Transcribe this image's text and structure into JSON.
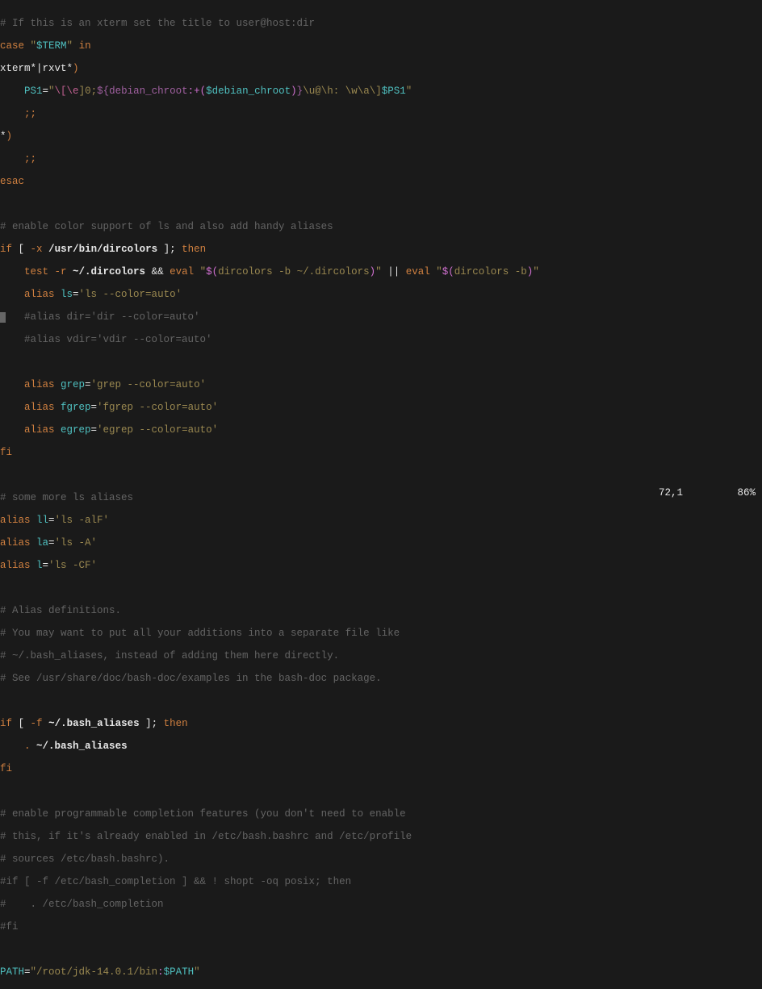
{
  "lines": {
    "l1": "# If this is an xterm set the title to user@host:dir",
    "l2a": "case ",
    "l2b": "\"",
    "l2c": "$TERM",
    "l2d": "\"",
    "l2e": " in",
    "l3a": "xterm*|rxvt*",
    "l3b": ")",
    "l4a": "    PS1",
    "l4b": "=",
    "l4c": "\"",
    "l4d": "\\[\\e",
    "l4e": "]0;",
    "l4f": "${debian_chroot",
    "l4g": ":+(",
    "l4h": "$debian_chroot",
    "l4i": ")",
    "l4j": "}",
    "l4k": "\\u@\\h: \\w\\a\\]",
    "l4l": "$PS1",
    "l4m": "\"",
    "l5": "    ;;",
    "l6a": "*",
    "l6b": ")",
    "l7": "    ;;",
    "l8": "esac",
    "l9": "",
    "l10": "# enable color support of ls and also add handy aliases",
    "l11a": "if",
    "l11b": " [ ",
    "l11c": "-x",
    "l11d": " ",
    "l11e": "/usr/bin/dircolors",
    "l11f": " ];",
    "l11g": " then",
    "l12a": "    test ",
    "l12b": "-r",
    "l12c": " ",
    "l12d": "~/.dircolors",
    "l12e": " && ",
    "l12f": "eval",
    "l12g": " ",
    "l12h": "\"",
    "l12i": "$(",
    "l12j": "dircolors -b ~/.dircolors",
    "l12k": ")",
    "l12l": "\"",
    "l12m": " || ",
    "l12n": "eval",
    "l12o": " ",
    "l12p": "\"",
    "l12q": "$(",
    "l12r": "dircolors -b",
    "l12s": ")",
    "l12t": "\"",
    "l13a": "    alias ",
    "l13b": "ls",
    "l13c": "=",
    "l13d": "'ls --color=auto'",
    "l14a": "    ",
    "l14b": "#alias dir='dir --color=auto'",
    "l15": "    #alias vdir='vdir --color=auto'",
    "l16": "",
    "l17a": "    alias ",
    "l17b": "grep",
    "l17c": "=",
    "l17d": "'grep --color=auto'",
    "l18a": "    alias ",
    "l18b": "fgrep",
    "l18c": "=",
    "l18d": "'fgrep --color=auto'",
    "l19a": "    alias ",
    "l19b": "egrep",
    "l19c": "=",
    "l19d": "'egrep --color=auto'",
    "l20": "fi",
    "l21": "",
    "l22": "# some more ls aliases",
    "l23a": "alias ",
    "l23b": "ll",
    "l23c": "=",
    "l23d": "'ls -alF'",
    "l24a": "alias ",
    "l24b": "la",
    "l24c": "=",
    "l24d": "'ls -A'",
    "l25a": "alias ",
    "l25b": "l",
    "l25c": "=",
    "l25d": "'ls -CF'",
    "l26": "",
    "l27": "# Alias definitions.",
    "l28": "# You may want to put all your additions into a separate file like",
    "l29": "# ~/.bash_aliases, instead of adding them here directly.",
    "l30": "# See /usr/share/doc/bash-doc/examples in the bash-doc package.",
    "l31": "",
    "l32a": "if",
    "l32b": " [ ",
    "l32c": "-f",
    "l32d": " ",
    "l32e": "~/.bash_aliases",
    "l32f": " ];",
    "l32g": " then",
    "l33a": "    ",
    "l33b": ".",
    "l33c": " ",
    "l33d": "~/.bash_aliases",
    "l34": "fi",
    "l35": "",
    "l36": "# enable programmable completion features (you don't need to enable",
    "l37": "# this, if it's already enabled in /etc/bash.bashrc and /etc/profile",
    "l38": "# sources /etc/bash.bashrc).",
    "l39": "#if [ -f /etc/bash_completion ] && ! shopt -oq posix; then",
    "l40": "#    . /etc/bash_completion",
    "l41": "#fi",
    "l42": "",
    "l43a": "PATH",
    "l43b": "=",
    "l43c": "\"",
    "l43d": "/root/jdk-14.0.1/bin",
    "l43e": ":",
    "l43f": "$PATH",
    "l43g": "\""
  },
  "status": {
    "pos": "72,1",
    "pct": "86%"
  }
}
